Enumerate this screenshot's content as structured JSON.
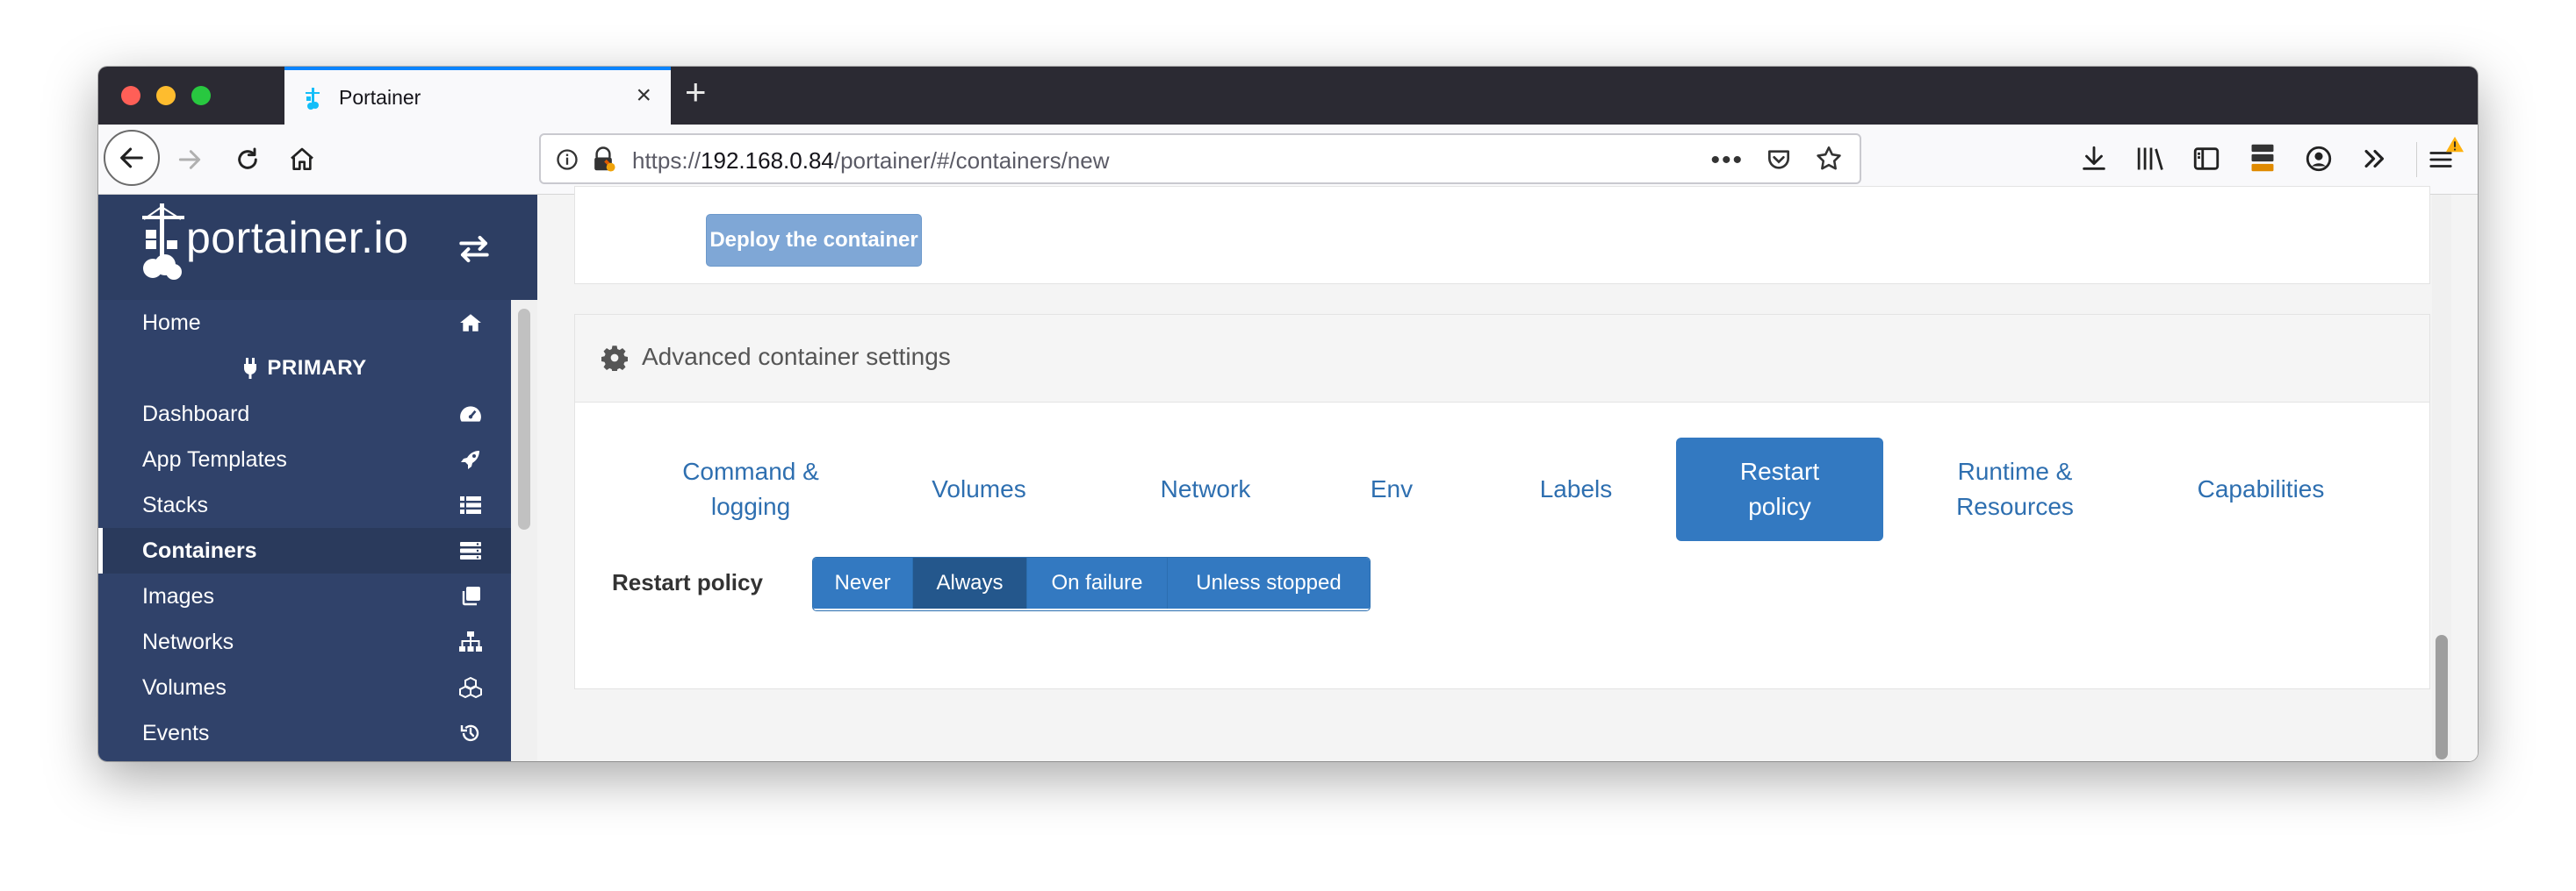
{
  "browser": {
    "tab_title": "Portainer",
    "url_prefix": "https://",
    "url_host": "192.168.0.84",
    "url_path": "/portainer/#/containers/new",
    "colors": {
      "tab_accent": "#0a84ff",
      "chrome_dark": "#2b2a33"
    }
  },
  "sidebar": {
    "logo_text": "portainer.io",
    "items": [
      {
        "label": "Home",
        "icon": "home-icon"
      },
      {
        "label": "Dashboard",
        "icon": "tachometer-icon"
      },
      {
        "label": "App Templates",
        "icon": "rocket-icon"
      },
      {
        "label": "Stacks",
        "icon": "list-icon"
      },
      {
        "label": "Containers",
        "icon": "server-icon"
      },
      {
        "label": "Images",
        "icon": "clone-icon"
      },
      {
        "label": "Networks",
        "icon": "sitemap-icon"
      },
      {
        "label": "Volumes",
        "icon": "cubes-icon"
      },
      {
        "label": "Events",
        "icon": "history-icon"
      }
    ],
    "endpoint_label": "PRIMARY",
    "active_item": "Containers",
    "colors": {
      "background": "#30426a"
    }
  },
  "main": {
    "deploy_button": "Deploy the container",
    "advanced_title": "Advanced container settings",
    "tabs": [
      {
        "label": "Command & logging"
      },
      {
        "label": "Volumes"
      },
      {
        "label": "Network"
      },
      {
        "label": "Env"
      },
      {
        "label": "Labels"
      },
      {
        "label": "Restart policy"
      },
      {
        "label": "Runtime & Resources"
      },
      {
        "label": "Capabilities"
      }
    ],
    "active_tab": "Restart policy",
    "restart_policy": {
      "label": "Restart policy",
      "options": [
        "Never",
        "Always",
        "On failure",
        "Unless stopped"
      ],
      "selected": "Always"
    },
    "colors": {
      "primary": "#3379c1",
      "primary_active": "#24578c",
      "link": "#2e6fb0"
    }
  }
}
